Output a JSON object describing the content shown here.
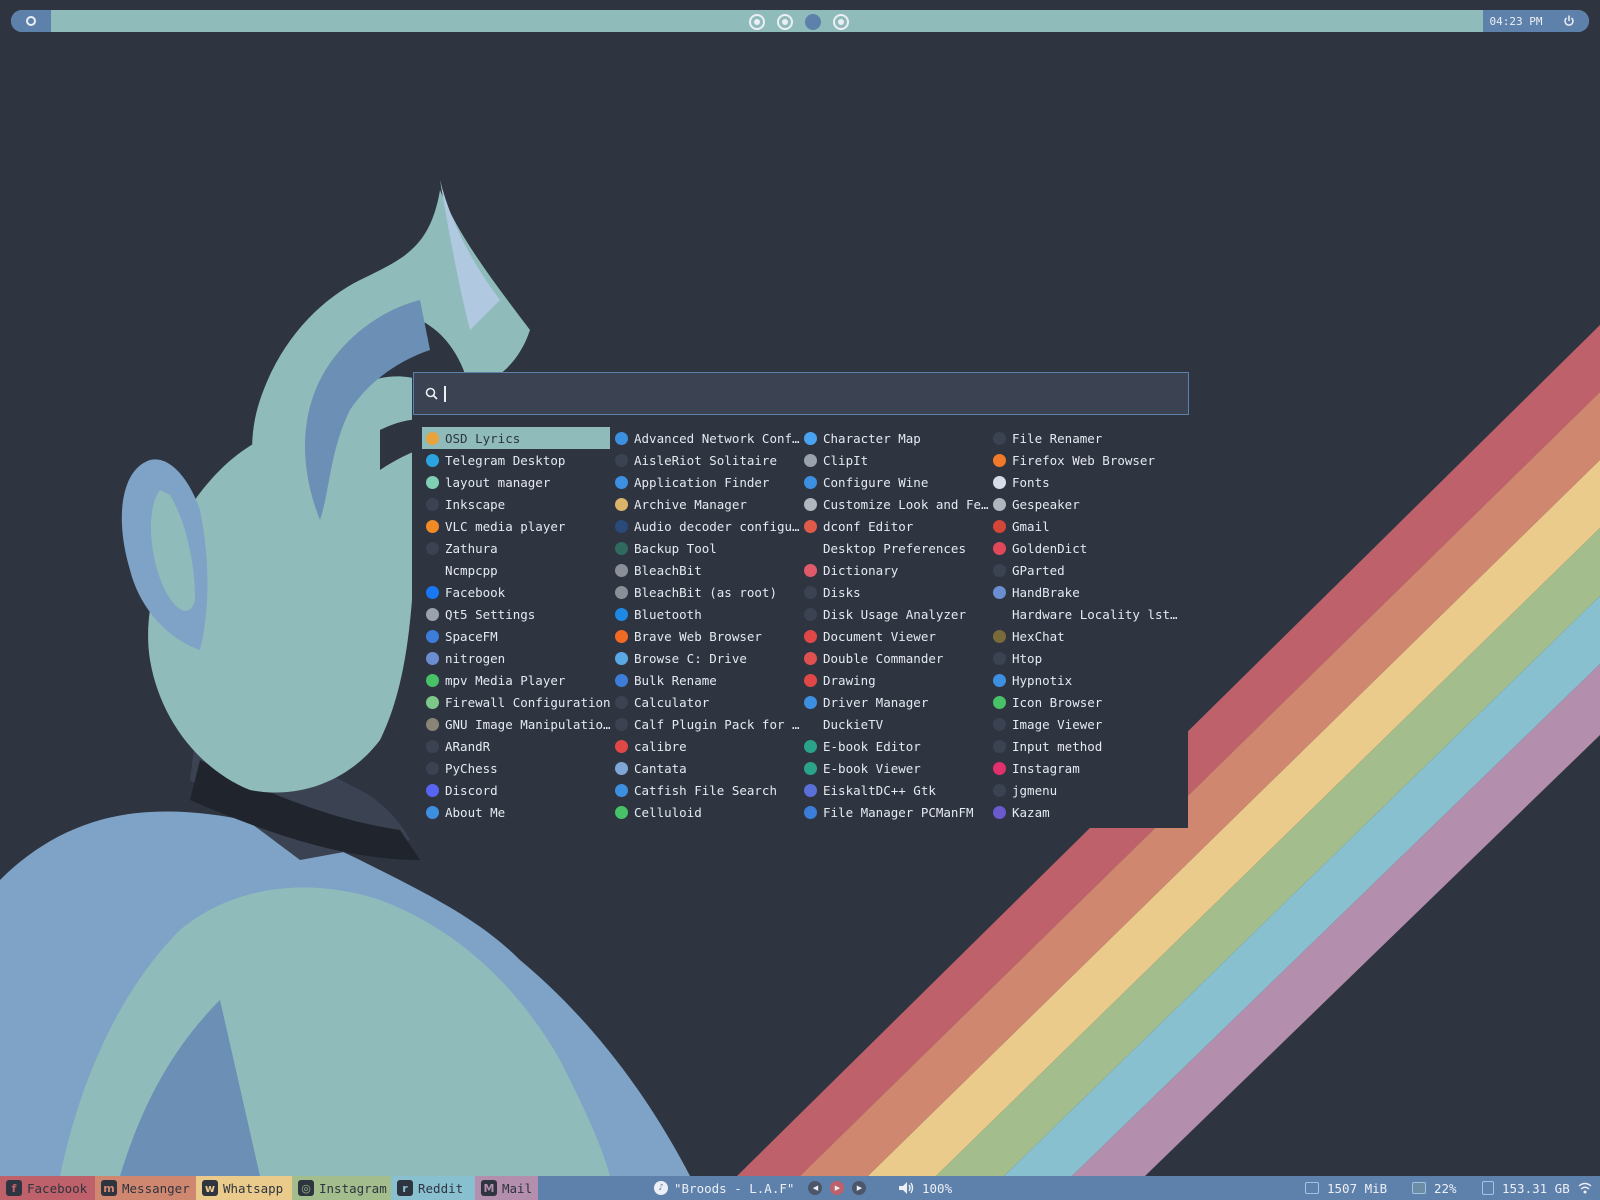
{
  "topbar": {
    "clock": "04:23 PM",
    "workspaces": [
      "inactive",
      "inactive",
      "active",
      "inactive"
    ]
  },
  "launcher": {
    "search_value": "",
    "columns": [
      [
        {
          "label": "OSD Lyrics",
          "icon": "osd-lyrics-icon",
          "color": "#e8a33c",
          "selected": true
        },
        {
          "label": "Telegram Desktop",
          "icon": "telegram-icon",
          "color": "#2aa3df"
        },
        {
          "label": "layout manager",
          "icon": "layout-manager-icon",
          "color": "#7ecfb3"
        },
        {
          "label": "Inkscape",
          "icon": "inkscape-icon",
          "color": "#3b4252"
        },
        {
          "label": "VLC media player",
          "icon": "vlc-icon",
          "color": "#f08a24"
        },
        {
          "label": "Zathura",
          "icon": "zathura-icon",
          "color": "#3b4252"
        },
        {
          "label": "Ncmpcpp",
          "icon": "",
          "color": ""
        },
        {
          "label": "Facebook",
          "icon": "facebook-icon",
          "color": "#1877f2"
        },
        {
          "label": "Qt5 Settings",
          "icon": "qt5-settings-icon",
          "color": "#9aa3ad"
        },
        {
          "label": "SpaceFM",
          "icon": "spacefm-icon",
          "color": "#3b7dd8"
        },
        {
          "label": "nitrogen",
          "icon": "nitrogen-icon",
          "color": "#6a8ecf"
        },
        {
          "label": "mpv Media Player",
          "icon": "mpv-icon",
          "color": "#47c266"
        },
        {
          "label": "Firewall Configuration",
          "icon": "firewall-icon",
          "color": "#7ec98a"
        },
        {
          "label": "GNU Image Manipulation…",
          "icon": "gimp-icon",
          "color": "#8a8478"
        },
        {
          "label": "ARandR",
          "icon": "arandr-icon",
          "color": "#3b4252"
        },
        {
          "label": "PyChess",
          "icon": "pychess-icon",
          "color": "#3b4252"
        },
        {
          "label": "Discord",
          "icon": "discord-icon",
          "color": "#5865f2"
        },
        {
          "label": "About Me",
          "icon": "about-me-icon",
          "color": "#3d8fe0"
        }
      ],
      [
        {
          "label": "Advanced Network Confi…",
          "icon": "network-config-icon",
          "color": "#3d8fe0"
        },
        {
          "label": "AisleRiot Solitaire",
          "icon": "solitaire-icon",
          "color": "#3b4252"
        },
        {
          "label": "Application Finder",
          "icon": "app-finder-icon",
          "color": "#3d8fe0"
        },
        {
          "label": "Archive Manager",
          "icon": "archive-manager-icon",
          "color": "#d9b46a"
        },
        {
          "label": "Audio decoder configur…",
          "icon": "audio-decoder-icon",
          "color": "#2a4a7a"
        },
        {
          "label": "Backup Tool",
          "icon": "backup-tool-icon",
          "color": "#2e6b5e"
        },
        {
          "label": "BleachBit",
          "icon": "bleachbit-icon",
          "color": "#8a8f98"
        },
        {
          "label": "BleachBit (as root)",
          "icon": "bleachbit-root-icon",
          "color": "#8a8f98"
        },
        {
          "label": "Bluetooth",
          "icon": "bluetooth-icon",
          "color": "#1e88e5"
        },
        {
          "label": "Brave Web Browser",
          "icon": "brave-icon",
          "color": "#f06a23"
        },
        {
          "label": "Browse C: Drive",
          "icon": "browse-drive-icon",
          "color": "#5aa9e6"
        },
        {
          "label": "Bulk Rename",
          "icon": "bulk-rename-icon",
          "color": "#3b7dd8"
        },
        {
          "label": "Calculator",
          "icon": "calculator-icon",
          "color": "#3b4252"
        },
        {
          "label": "Calf Plugin Pack for J…",
          "icon": "calf-plugin-icon",
          "color": "#3b4252"
        },
        {
          "label": "calibre",
          "icon": "calibre-icon",
          "color": "#e04848"
        },
        {
          "label": "Cantata",
          "icon": "cantata-icon",
          "color": "#7fa7d6"
        },
        {
          "label": "Catfish File Search",
          "icon": "catfish-icon",
          "color": "#3d8fe0"
        },
        {
          "label": "Celluloid",
          "icon": "celluloid-icon",
          "color": "#47c266"
        }
      ],
      [
        {
          "label": "Character Map",
          "icon": "character-map-icon",
          "color": "#4aa3f0"
        },
        {
          "label": "ClipIt",
          "icon": "clipit-icon",
          "color": "#9aa3ad"
        },
        {
          "label": "Configure Wine",
          "icon": "wine-icon",
          "color": "#3d8fe0"
        },
        {
          "label": "Customize Look and Feel",
          "icon": "customize-look-icon",
          "color": "#b0b6bd"
        },
        {
          "label": "dconf Editor",
          "icon": "dconf-editor-icon",
          "color": "#e05a4a"
        },
        {
          "label": "Desktop Preferences",
          "icon": "",
          "color": ""
        },
        {
          "label": "Dictionary",
          "icon": "dictionary-icon",
          "color": "#e05a6a"
        },
        {
          "label": "Disks",
          "icon": "disks-icon",
          "color": "#3b4252"
        },
        {
          "label": "Disk Usage Analyzer",
          "icon": "disk-usage-icon",
          "color": "#3b4252"
        },
        {
          "label": "Document Viewer",
          "icon": "document-viewer-icon",
          "color": "#e04848"
        },
        {
          "label": "Double Commander",
          "icon": "double-commander-icon",
          "color": "#e05050"
        },
        {
          "label": "Drawing",
          "icon": "drawing-icon",
          "color": "#e04848"
        },
        {
          "label": "Driver Manager",
          "icon": "driver-manager-icon",
          "color": "#3d8fe0"
        },
        {
          "label": "DuckieTV",
          "icon": "",
          "color": ""
        },
        {
          "label": "E-book Editor",
          "icon": "ebook-editor-icon",
          "color": "#2aa38a"
        },
        {
          "label": "E-book Viewer",
          "icon": "ebook-viewer-icon",
          "color": "#2aa38a"
        },
        {
          "label": "EiskaltDC++ Gtk",
          "icon": "eiskaltdc-icon",
          "color": "#5a6fd8"
        },
        {
          "label": "File Manager PCManFM",
          "icon": "pcmanfm-icon",
          "color": "#3b7dd8"
        }
      ],
      [
        {
          "label": "File Renamer",
          "icon": "file-renamer-icon",
          "color": "#3b4252"
        },
        {
          "label": "Firefox Web Browser",
          "icon": "firefox-icon",
          "color": "#f07a2a"
        },
        {
          "label": "Fonts",
          "icon": "fonts-icon",
          "color": "#d8dee9"
        },
        {
          "label": "Gespeaker",
          "icon": "gespeaker-icon",
          "color": "#b0b6bd"
        },
        {
          "label": "Gmail",
          "icon": "gmail-icon",
          "color": "#d44638"
        },
        {
          "label": "GoldenDict",
          "icon": "goldendict-icon",
          "color": "#e0485a"
        },
        {
          "label": "GParted",
          "icon": "gparted-icon",
          "color": "#3b4252"
        },
        {
          "label": "HandBrake",
          "icon": "handbrake-icon",
          "color": "#6a8ecf"
        },
        {
          "label": "Hardware Locality lsto…",
          "icon": "",
          "color": ""
        },
        {
          "label": "HexChat",
          "icon": "hexchat-icon",
          "color": "#7a6a3a"
        },
        {
          "label": "Htop",
          "icon": "htop-icon",
          "color": "#3b4252"
        },
        {
          "label": "Hypnotix",
          "icon": "hypnotix-icon",
          "color": "#3d8fe0"
        },
        {
          "label": "Icon Browser",
          "icon": "icon-browser-icon",
          "color": "#47c266"
        },
        {
          "label": "Image Viewer",
          "icon": "image-viewer-icon",
          "color": "#3b4252"
        },
        {
          "label": "Input method",
          "icon": "input-method-icon",
          "color": "#3b4252"
        },
        {
          "label": "Instagram",
          "icon": "instagram-icon",
          "color": "#e1306c"
        },
        {
          "label": "jgmenu",
          "icon": "jgmenu-icon",
          "color": "#3b4252"
        },
        {
          "label": "Kazam",
          "icon": "kazam-icon",
          "color": "#6a5acd"
        }
      ]
    ]
  },
  "bottombar": {
    "quick_launch": [
      {
        "label": "Facebook",
        "icon": "facebook-icon",
        "bg": "#bf616a",
        "icon_glyph": "f"
      },
      {
        "label": "Messanger",
        "icon": "messenger-icon",
        "bg": "#d08770",
        "icon_glyph": "m"
      },
      {
        "label": "Whatsapp",
        "icon": "whatsapp-icon",
        "bg": "#ebcb8b",
        "icon_glyph": "w"
      },
      {
        "label": "Instagram",
        "icon": "instagram-icon",
        "bg": "#a3be8c",
        "icon_glyph": "◎"
      },
      {
        "label": "Reddit",
        "icon": "reddit-icon",
        "bg": "#88c0d0",
        "icon_glyph": "r"
      },
      {
        "label": "Mail",
        "icon": "mail-icon",
        "bg": "#b48ead",
        "icon_glyph": "M"
      }
    ],
    "now_playing": "\"Broods - L.A.F\"",
    "volume": "100%",
    "memory": "1507 MiB",
    "cpu": "22%",
    "disk": "153.31 GB"
  },
  "colors": {
    "accent": "#5e81ac",
    "highlight": "#8fbcbb",
    "background": "#2e3440",
    "rainbow": [
      "#bf616a",
      "#d08770",
      "#ebcb8b",
      "#a3be8c",
      "#88c0d0",
      "#b48ead"
    ]
  }
}
